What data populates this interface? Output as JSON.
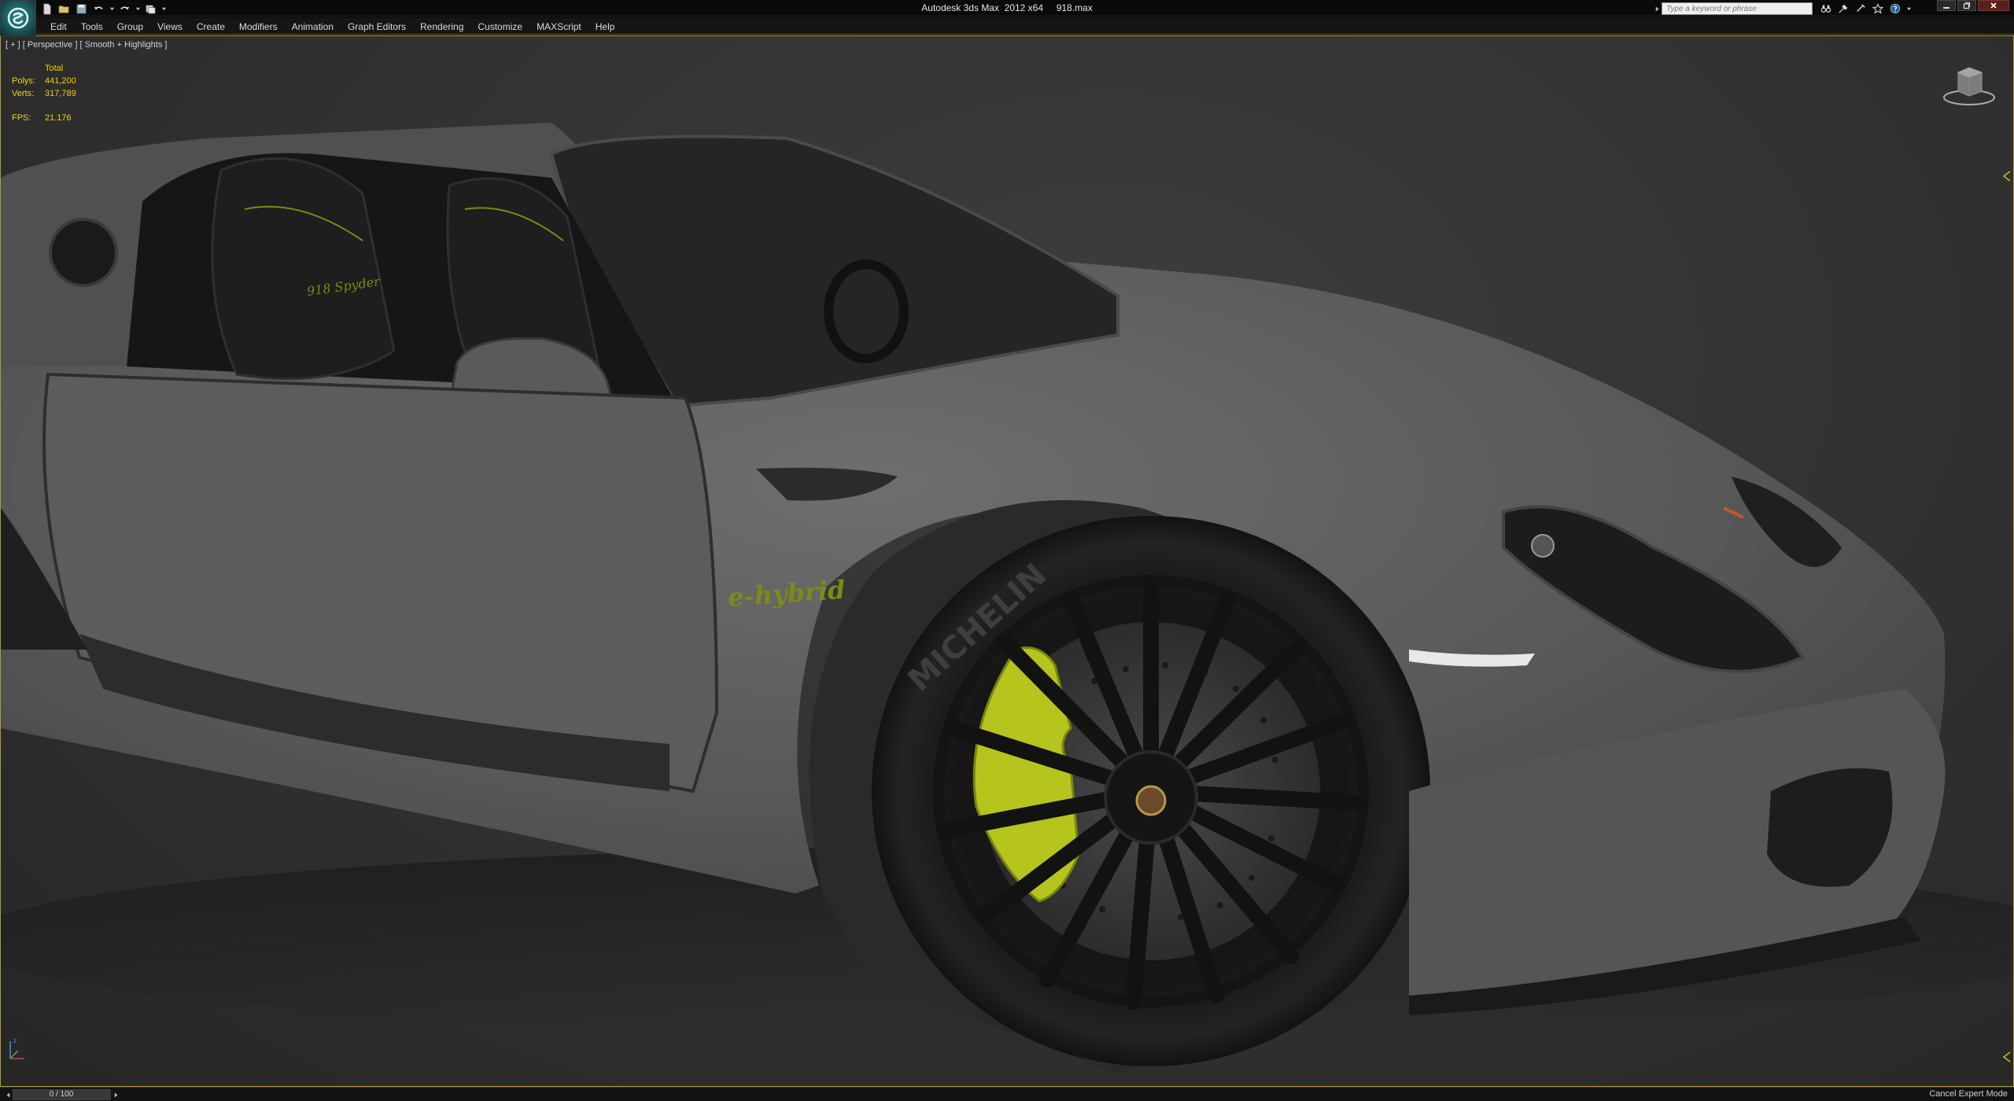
{
  "window": {
    "title": "Autodesk 3ds Max  2012 x64     918.max"
  },
  "infocenter": {
    "search_placeholder": "Type a keyword or phrase"
  },
  "menu": {
    "items": [
      "Edit",
      "Tools",
      "Group",
      "Views",
      "Create",
      "Modifiers",
      "Animation",
      "Graph Editors",
      "Rendering",
      "Customize",
      "MAXScript",
      "Help"
    ]
  },
  "viewport": {
    "label": "[ + ] [ Perspective ] [ Smooth + Highlights ]",
    "stats": {
      "header": "Total",
      "polys_label": "Polys:",
      "polys_value": "441,200",
      "verts_label": "Verts:",
      "verts_value": "317,789",
      "fps_label": "FPS:",
      "fps_value": "21.176"
    },
    "stats_color": "#f2d200",
    "border_color": "#b79a30"
  },
  "car": {
    "badge_text": "e-hybrid",
    "seat_text": "918 Spyder",
    "tire_text": "MICHELIN",
    "accent_color": "#b6c41e"
  },
  "statusbar": {
    "time_label": "0 / 100",
    "cancel_expert_label": "Cancel Expert Mode"
  },
  "icons": [
    "app-logo-icon",
    "new-file-icon",
    "open-file-icon",
    "save-icon",
    "undo-icon",
    "redo-icon",
    "project-folder-icon",
    "binoculars-icon",
    "subscription-icon",
    "star-icon",
    "help-icon",
    "minimize-icon",
    "restore-icon",
    "close-icon",
    "viewcube-icon",
    "axis-tripod-icon"
  ]
}
